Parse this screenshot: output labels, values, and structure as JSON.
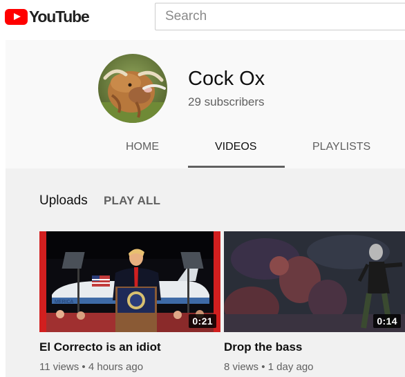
{
  "header": {
    "logo_text": "YouTube",
    "search_placeholder": "Search"
  },
  "channel": {
    "name": "Cock Ox",
    "subscribers": "29 subscribers",
    "tabs": [
      {
        "label": "HOME",
        "active": false
      },
      {
        "label": "VIDEOS",
        "active": true
      },
      {
        "label": "PLAYLISTS",
        "active": false
      }
    ]
  },
  "section": {
    "title": "Uploads",
    "play_all": "PLAY ALL"
  },
  "videos": [
    {
      "title": "El Correcto is an idiot",
      "duration": "0:21",
      "views": "11 views",
      "age": "4 hours ago"
    },
    {
      "title": "Drop the bass",
      "duration": "0:14",
      "views": "8 views",
      "age": "1 day ago"
    }
  ],
  "colors": {
    "brand_red": "#ff0000",
    "header_bg": "#f9f9f9",
    "content_bg": "#f1f1f1",
    "secondary_text": "#606060"
  }
}
